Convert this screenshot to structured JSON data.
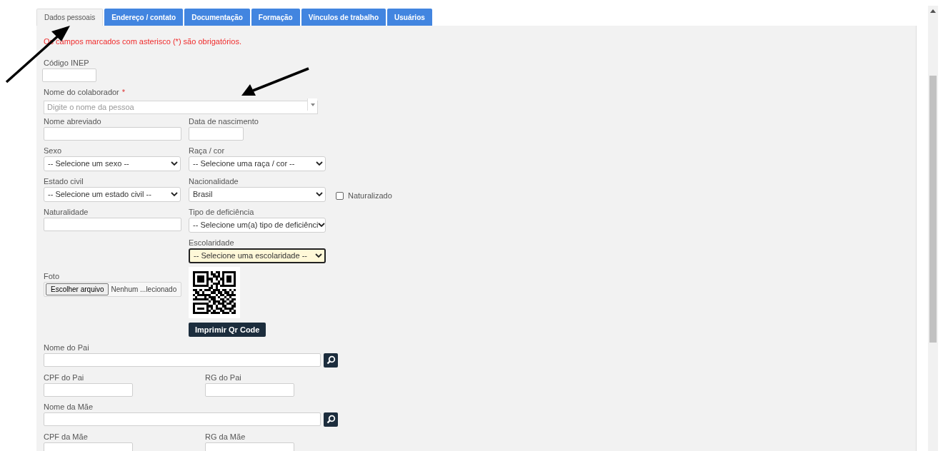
{
  "tabs": [
    {
      "label": "Dados pessoais",
      "selected": true
    },
    {
      "label": "Endereço / contato",
      "selected": false
    },
    {
      "label": "Documentação",
      "selected": false
    },
    {
      "label": "Formação",
      "selected": false
    },
    {
      "label": "Vínculos de trabalho",
      "selected": false
    },
    {
      "label": "Usuários",
      "selected": false
    }
  ],
  "required_notice": "Os campos marcados com asterisco (*) são obrigatórios.",
  "rows": [
    {
      "kind": "fields",
      "fields": [
        {
          "kind": "code",
          "label": "Código INEP"
        }
      ]
    },
    {
      "kind": "fields",
      "fields": [
        {
          "kind": "autocomplete",
          "label": "Nome do colaborador",
          "required_mark": "*",
          "placeholder": "Digite o nome da pessoa"
        }
      ]
    },
    {
      "kind": "fields",
      "fields": [
        {
          "kind": "text",
          "label": "Nome abreviado"
        },
        {
          "kind": "date",
          "label": "Data de nascimento"
        }
      ]
    },
    {
      "kind": "fields",
      "fields": [
        {
          "kind": "select",
          "label": "Sexo",
          "value": "-- Selecione um sexo --",
          "focused": false
        },
        {
          "kind": "select",
          "label": "Raça / cor",
          "value": "-- Selecione uma raça / cor --",
          "focused": false
        }
      ]
    },
    {
      "kind": "fields",
      "fields": [
        {
          "kind": "select",
          "label": "Estado civil",
          "value": "-- Selecione um estado civil --",
          "focused": false
        },
        {
          "kind": "select",
          "label": "Nacionalidade",
          "value": "Brasil",
          "focused": false
        },
        {
          "kind": "checkbox",
          "label": "Naturalizado",
          "checked": false
        }
      ]
    },
    {
      "kind": "fields",
      "fields": [
        {
          "kind": "text",
          "label": "Naturalidade"
        },
        {
          "kind": "select",
          "label": "Tipo de deficiência",
          "value": "-- Selecione um(a) tipo de deficiênci",
          "focused": false
        }
      ]
    },
    {
      "kind": "photo",
      "file": {
        "label": "Foto",
        "button": "Escolher arquivo",
        "status": "Nenhum ...lecionado"
      },
      "escolaridade": {
        "label": "Escolaridade",
        "value": "-- Selecione uma escolaridade --",
        "focused": true
      },
      "print_button": "Imprimir Qr Code"
    },
    {
      "kind": "fields",
      "fields": [
        {
          "kind": "lookup",
          "label": "Nome do Pai"
        }
      ]
    },
    {
      "kind": "fields",
      "fields": [
        {
          "kind": "document",
          "label": "CPF do Pai"
        },
        {
          "kind": "document",
          "label": "RG do Pai"
        }
      ]
    },
    {
      "kind": "fields",
      "fields": [
        {
          "kind": "lookup",
          "label": "Nome da Mãe"
        }
      ]
    },
    {
      "kind": "fields",
      "fields": [
        {
          "kind": "document",
          "label": "CPF da Mãe"
        },
        {
          "kind": "document",
          "label": "RG da Mãe"
        }
      ]
    }
  ],
  "annotations": [
    {
      "kind": "arrow"
    },
    {
      "kind": "arrow"
    }
  ]
}
